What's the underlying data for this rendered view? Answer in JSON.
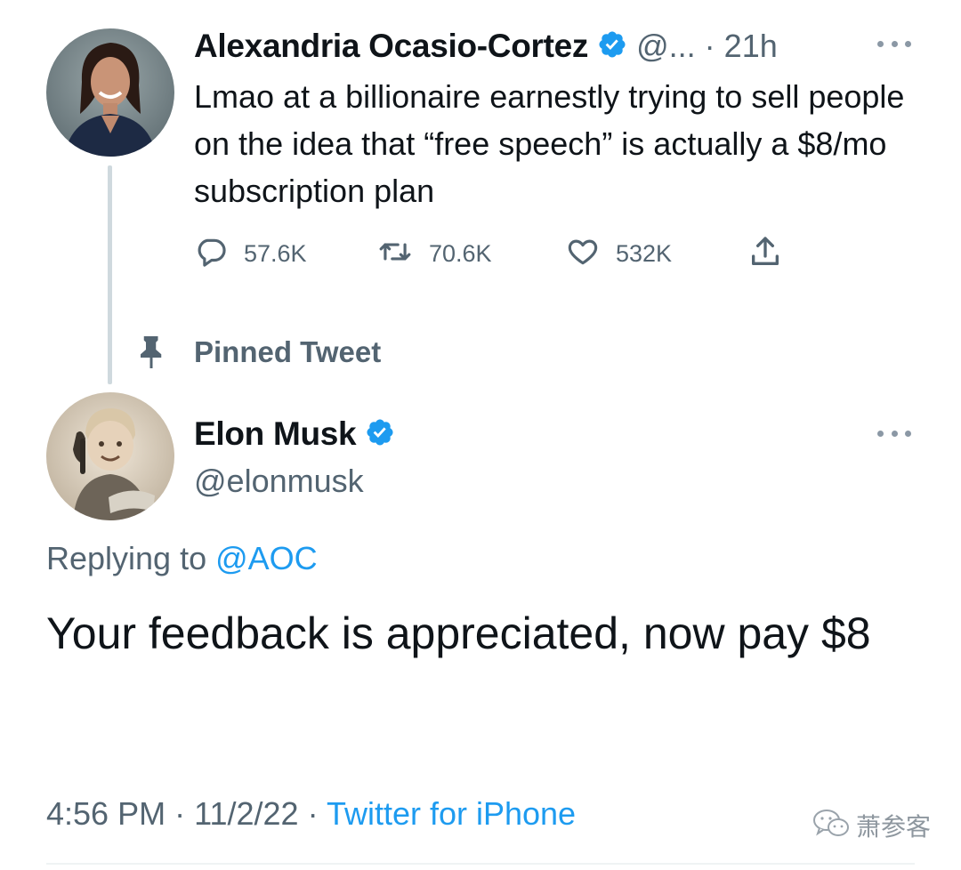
{
  "parent_tweet": {
    "author_name": "Alexandria Ocasio-Cortez",
    "handle": "@...",
    "separator": "·",
    "time": "21h",
    "text": "Lmao at a billionaire earnestly trying to sell people on the idea that “free speech” is actually a $8/mo subscription plan",
    "replies": "57.6K",
    "retweets": "70.6K",
    "likes": "532K"
  },
  "pinned": {
    "label": "Pinned Tweet"
  },
  "main_tweet": {
    "author_name": "Elon Musk",
    "handle": "@elonmusk",
    "replying_prefix": "Replying to",
    "replying_to": "@AOC",
    "text": "Your feedback is appreciated, now pay $8",
    "time": "4:56 PM",
    "sep1": "·",
    "date": "11/2/22",
    "sep2": "·",
    "source": "Twitter for iPhone"
  },
  "watermark": {
    "text": "萧参客"
  },
  "colors": {
    "accent": "#1d9bf0",
    "secondary_text": "#536471",
    "primary_text": "#0f1419",
    "thread_line": "#cfd9de"
  },
  "icons": {
    "verified": "verified-badge-icon",
    "more": "more-horizontal-icon",
    "reply": "reply-bubble-icon",
    "retweet": "retweet-icon",
    "like": "heart-icon",
    "share": "share-upload-icon",
    "pin": "pin-icon",
    "watermark": "wechat-icon"
  }
}
